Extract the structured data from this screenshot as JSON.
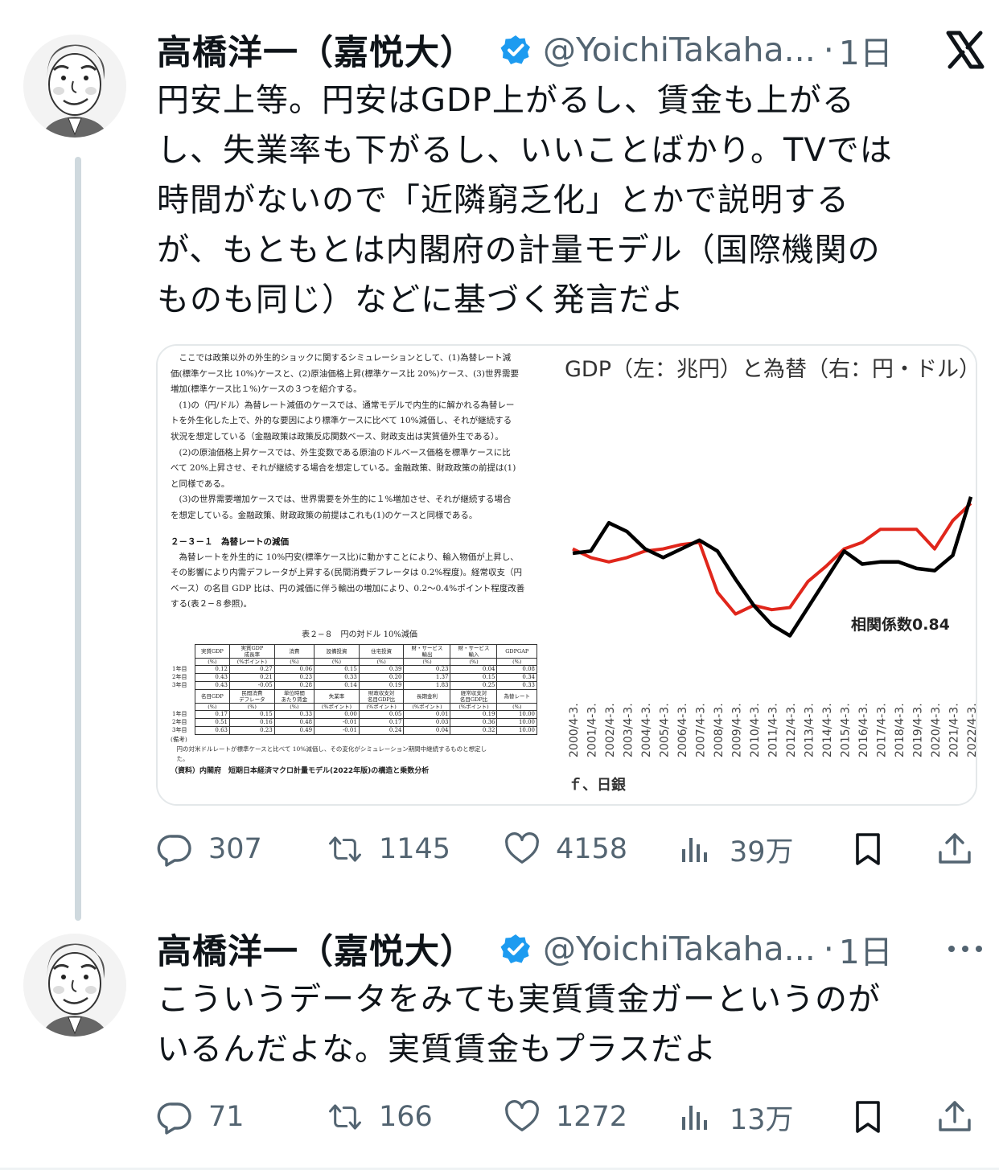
{
  "tweets": [
    {
      "display_name": "高橋洋一（嘉悦大）",
      "handle": "@YoichiTakaha...",
      "separator": "·",
      "time": "1日",
      "text": "円安上等。円安はGDP上がるし、賃金も上がる\nし、失業率も下がるし、いいことばかり。TVでは\n時間がないので「近隣窮乏化」とかで説明する\nが、もともとは内閣府の計量モデル（国際機関の\nものも同じ）などに基づく発言だよ",
      "replies": "307",
      "retweets": "1145",
      "likes": "4158",
      "views": "39万"
    },
    {
      "display_name": "高橋洋一（嘉悦大）",
      "handle": "@YoichiTakaha...",
      "separator": "·",
      "time": "1日",
      "text": "こういうデータをみても実質賃金ガーというのが\nいるんだよな。実質賃金もプラスだよ",
      "replies": "71",
      "retweets": "166",
      "likes": "1272",
      "views": "13万"
    }
  ],
  "icons": {
    "brand": "x-logo-icon",
    "more": "more-dots-icon",
    "verified": "verified-badge-icon",
    "reply": "reply-icon",
    "retweet": "retweet-icon",
    "like": "heart-icon",
    "views": "views-icon",
    "bookmark": "bookmark-icon",
    "share": "share-icon"
  },
  "colors": {
    "text": "#0f1419",
    "secondary": "#536471",
    "verified": "#1d9bf0",
    "thread_line": "#cfd9de",
    "chart_gdp": "#e0261b",
    "chart_fx": "#000000"
  },
  "document": {
    "paragraphs": [
      "　ここでは政策以外の外生的ショックに関するシミュレーションとして、(1)為替レート減",
      "価(標準ケース比 10%)ケースと、(2)原油価格上昇(標準ケース比 20%)ケース、(3)世界需要",
      "増加(標準ケース比１%)ケースの３つを紹介する。",
      "　(1)の（円/ドル）為替レート減価のケースでは、通常モデルで内生的に解かれる為替レー",
      "トを外生化した上で、外的な要因により標準ケースに比べて 10%減価し、それが継続する",
      "状況を想定している（金融政策は政策反応関数ベース、財政支出は実質値外生である）。",
      "　(2)の原油価格上昇ケースでは、外生変数である原油のドルベース価格を標準ケースに比",
      "べて 20%上昇させ、それが継続する場合を想定している。金融政策、財政政策の前提は(1)",
      "と同様である。",
      "　(3)の世界需要増加ケースでは、世界需要を外生的に１%増加させ、それが継続する場合",
      "を想定している。金融政策、財政政策の前提はこれも(1)のケースと同様である。"
    ],
    "section_heading": "２－３－１　為替レートの減価",
    "section_paragraphs": [
      "　為替レートを外生的に 10%円安(標準ケース比)に動かすことにより、輸入物価が上昇し、",
      "その影響により内需デフレータが上昇する(民間消費デフレータは 0.2%程度)。経常収支（円",
      "ベース）の名目 GDP 比は、円の減価に伴う輸出の増加により、0.2～0.4%ポイント程度改善",
      "する(表２−８参照)。"
    ],
    "table_title": "表２−８　円の対ドル 10%減価",
    "table1": {
      "headers": [
        "実質GDP",
        "実質GDP\n成長率",
        "消費",
        "設備投資",
        "住宅投資",
        "財・サービス\n輸出",
        "財・サービス\n輸入",
        "GDPGAP"
      ],
      "units": [
        "(%)",
        "(%ポイント)",
        "(%)",
        "(%)",
        "(%)",
        "(%)",
        "(%)",
        "(%)"
      ],
      "rows": [
        {
          "label": "1年目",
          "values": [
            "0.12",
            "0.27",
            "0.06",
            "0.15",
            "0.39",
            "0.23",
            "0.04",
            "0.08"
          ]
        },
        {
          "label": "2年目",
          "values": [
            "0.43",
            "0.21",
            "0.23",
            "0.33",
            "0.20",
            "1.37",
            "0.15",
            "0.34"
          ]
        },
        {
          "label": "3年目",
          "values": [
            "0.43",
            "-0.05",
            "0.28",
            "0.14",
            "0.19",
            "1.83",
            "0.25",
            "0.33"
          ]
        }
      ]
    },
    "table2": {
      "headers": [
        "名目GDP",
        "民間消費\nデフレータ",
        "単位時間\nあたり賃金",
        "失業率",
        "財政収支対\n名目GDP比",
        "長期金利",
        "経常収支対\n名目GDP比",
        "為替レート"
      ],
      "units": [
        "(%)",
        "(%)",
        "(%)",
        "(%ポイント)",
        "(%ポイント)",
        "(%ポイント)",
        "(%ポイント)",
        "(%)"
      ],
      "rows": [
        {
          "label": "1年目",
          "values": [
            "0.17",
            "0.15",
            "0.33",
            "0.00",
            "0.05",
            "0.01",
            "0.19",
            "10.00"
          ]
        },
        {
          "label": "2年目",
          "values": [
            "0.51",
            "0.16",
            "0.48",
            "-0.01",
            "0.17",
            "0.03",
            "0.36",
            "10.00"
          ]
        },
        {
          "label": "3年目",
          "values": [
            "0.63",
            "0.23",
            "0.49",
            "-0.01",
            "0.24",
            "0.04",
            "0.32",
            "10.00"
          ]
        }
      ]
    },
    "note_head": "(備考)",
    "note_lines": [
      "　円の対米ドルレートが標準ケースと比べて 10%減価し、その変化がシミュレーション期間中継続するものと想定し",
      "　た。"
    ],
    "source": "（資料）内閣府　短期日本経済マクロ計量モデル(2022年版)の構造と乗数分析"
  },
  "chart_data": {
    "type": "line",
    "title": "GDP（左：兆円）と為替（右：円・ドル）の",
    "annotation": "相関係数0.84",
    "source_fragment": "ｆ、日銀",
    "x": [
      "2000/4-3.",
      "2001/4-3.",
      "2002/4-3.",
      "2003/4-3.",
      "2004/4-3.",
      "2005/4-3.",
      "2006/4-3.",
      "2007/4-3.",
      "2008/4-3.",
      "2009/4-3.",
      "2010/4-3.",
      "2011/4-3.",
      "2012/4-3.",
      "2013/4-3.",
      "2014/4-3.",
      "2015/4-3.",
      "2016/4-3.",
      "2017/4-3.",
      "2018/4-3.",
      "2019/4-3.",
      "2020/4-3.",
      "2021/4-3.",
      "2022/4-3."
    ],
    "series": [
      {
        "color": "#e0261b",
        "values": [
          0.62,
          0.58,
          0.56,
          0.58,
          0.61,
          0.62,
          0.64,
          0.65,
          0.42,
          0.32,
          0.36,
          0.34,
          0.35,
          0.47,
          0.54,
          0.62,
          0.65,
          0.71,
          0.71,
          0.71,
          0.62,
          0.75,
          0.83
        ]
      },
      {
        "color": "#000000",
        "values": [
          0.6,
          0.61,
          0.74,
          0.7,
          0.62,
          0.58,
          0.62,
          0.66,
          0.61,
          0.48,
          0.36,
          0.27,
          0.22,
          0.35,
          0.48,
          0.61,
          0.55,
          0.56,
          0.56,
          0.53,
          0.52,
          0.59,
          0.86
        ]
      }
    ]
  }
}
